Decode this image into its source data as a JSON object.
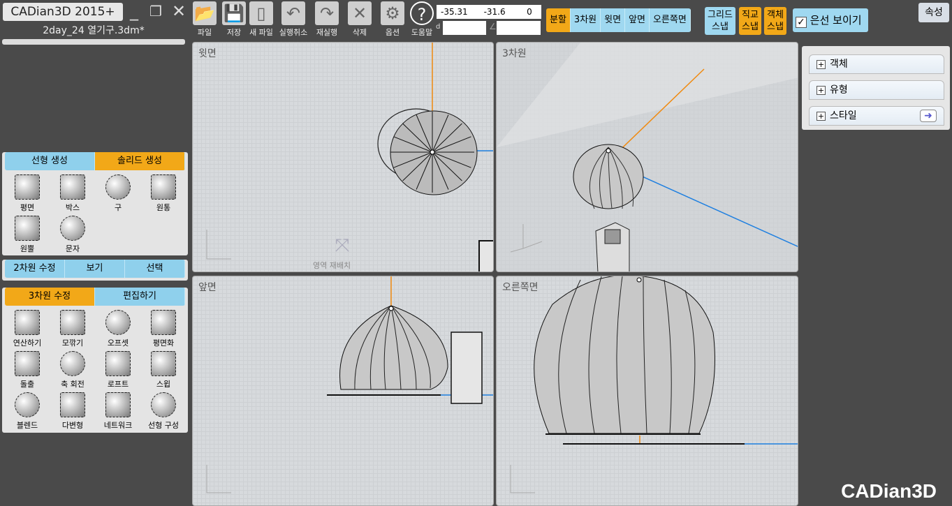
{
  "app": {
    "title": "CADian3D 2015+",
    "filename": "2day_24 열기구.3dm*",
    "logo": "CADian3D"
  },
  "toolbar": [
    {
      "label": "파일",
      "icon": "folder-icon"
    },
    {
      "label": "저장",
      "icon": "save-icon"
    },
    {
      "label": "새 파일",
      "icon": "new-file-icon"
    },
    {
      "label": "실행취소",
      "icon": "undo-icon"
    },
    {
      "label": "재실행",
      "icon": "redo-icon"
    },
    {
      "label": "삭제",
      "icon": "delete-icon"
    },
    {
      "label": "옵션",
      "icon": "gear-icon"
    },
    {
      "label": "도움말",
      "icon": "help-icon"
    }
  ],
  "coords": {
    "x": "-35.31",
    "y": "-31.6",
    "z": "0",
    "d_label": "d",
    "angle_label": "∠",
    "d_value": "",
    "angle_value": ""
  },
  "views": [
    {
      "label": "분할",
      "active": true
    },
    {
      "label": "3차원"
    },
    {
      "label": "윗면"
    },
    {
      "label": "앞면"
    },
    {
      "label": "오른쪽면"
    }
  ],
  "snaps": [
    {
      "l1": "그리드",
      "l2": "스냅",
      "active": false
    },
    {
      "l1": "직교",
      "l2": "스냅",
      "active": true
    },
    {
      "l1": "객체",
      "l2": "스냅",
      "active": true
    }
  ],
  "hidden_lines": {
    "label": "은선 보이기",
    "checked": true
  },
  "properties": "속성",
  "right_panel": [
    "객체",
    "유형",
    "스타일"
  ],
  "create_tabs": [
    {
      "label": "선형 생성"
    },
    {
      "label": "솔리드 생성",
      "active": true
    }
  ],
  "create_tools": [
    "평면",
    "박스",
    "구",
    "원통",
    "원뿔",
    "문자"
  ],
  "mid_tabs": [
    "2차원 수정",
    "보기",
    "선택"
  ],
  "edit_tabs": [
    {
      "label": "3차원 수정",
      "active": true
    },
    {
      "label": "편집하기"
    }
  ],
  "edit_tools": [
    "연산하기",
    "모깎기",
    "오프셋",
    "평면화",
    "돌출",
    "축 회전",
    "로프트",
    "스윕",
    "블렌드",
    "다변형",
    "네트워크",
    "선형 구성"
  ],
  "viewports": {
    "top": "윗면",
    "perspective": "3차원",
    "front": "앞면",
    "right": "오른쪽면",
    "rearrange": "영역 재배치"
  },
  "colors": {
    "active": "#f2a818",
    "inactive": "#9fd8f0",
    "axis_x": "#1e7fe0",
    "axis_y": "#f08a10"
  }
}
